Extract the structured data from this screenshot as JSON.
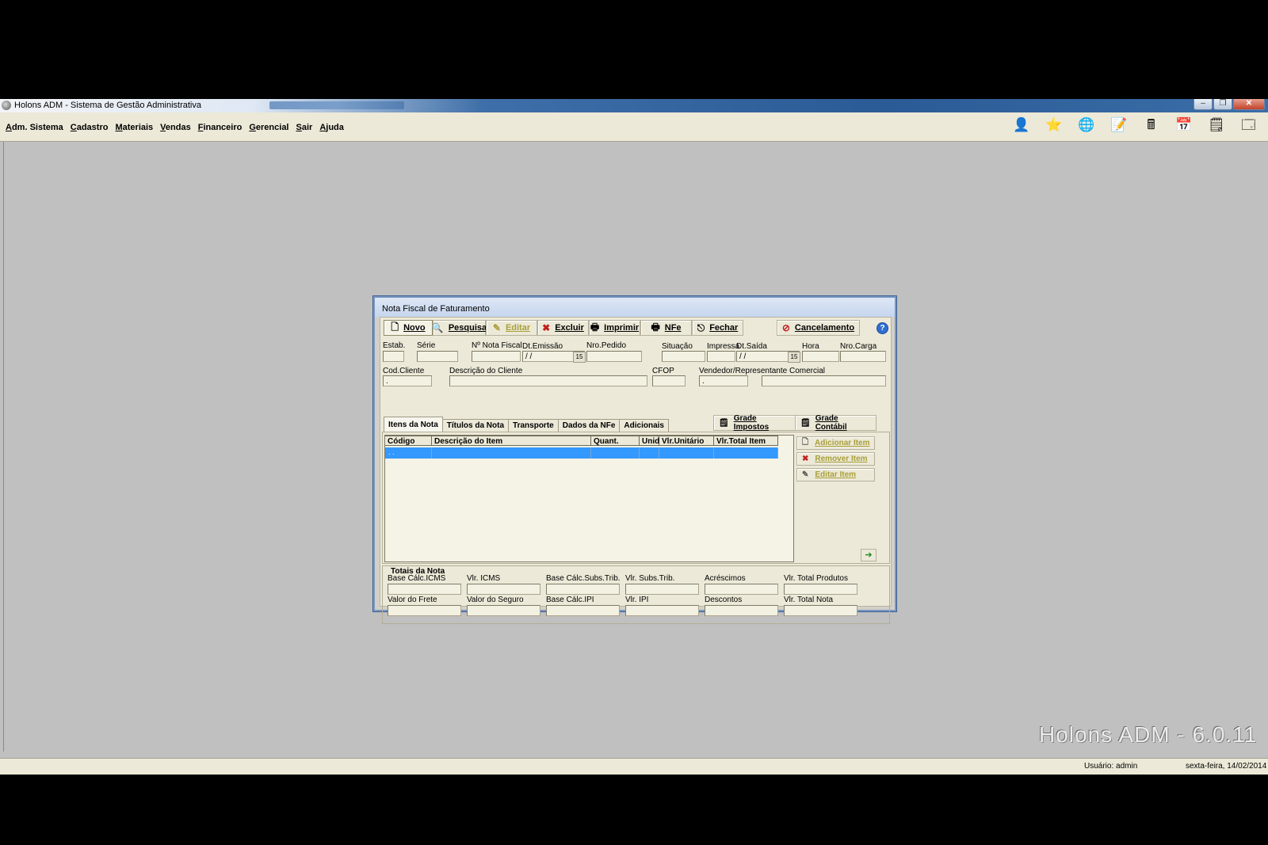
{
  "window": {
    "title": "Holons ADM - Sistema de Gestão Administrativa",
    "controls": {
      "minimize": "–",
      "restore": "❐",
      "close": "✕"
    }
  },
  "menu": [
    {
      "label": "Adm. Sistema",
      "hotkey": "A",
      "rest": "dm. Sistema"
    },
    {
      "label": "Cadastro",
      "hotkey": "C",
      "rest": "adastro"
    },
    {
      "label": "Materiais",
      "hotkey": "M",
      "rest": "ateriais"
    },
    {
      "label": "Vendas",
      "hotkey": "V",
      "rest": "endas"
    },
    {
      "label": "Financeiro",
      "hotkey": "F",
      "rest": "inanceiro"
    },
    {
      "label": "Gerencial",
      "hotkey": "G",
      "rest": "erencial"
    },
    {
      "label": "Sair",
      "hotkey": "S",
      "rest": "air"
    },
    {
      "label": "Ajuda",
      "hotkey": "A",
      "rest": "juda"
    }
  ],
  "toolbar_icons": [
    {
      "name": "user-icon",
      "glyph": "👤"
    },
    {
      "name": "star-icon",
      "glyph": "⭐"
    },
    {
      "name": "globe-icon",
      "glyph": "🌐"
    },
    {
      "name": "notepad-edit-icon",
      "glyph": "📝"
    },
    {
      "name": "calculator-icon",
      "glyph": "🖩"
    },
    {
      "name": "calendar-icon",
      "glyph": "📅"
    },
    {
      "name": "xml-notes-icon",
      "glyph": "🗒"
    },
    {
      "name": "window-icon",
      "glyph": "🗔"
    }
  ],
  "watermark": "Holons ADM - 6.0.11",
  "status": {
    "user": "Usuário: admin",
    "date": "sexta-feira, 14/02/2014"
  },
  "dialog": {
    "title": "Nota Fiscal de Faturamento",
    "buttons": {
      "novo": "Novo",
      "pesquisa": "Pesquisa",
      "editar": "Editar",
      "excluir": "Excluir",
      "imprimir": "Imprimir",
      "nfe": "NFe",
      "fechar": "Fechar",
      "cancelamento": "Cancelamento",
      "help": "?"
    },
    "fields": {
      "estab": "Estab.",
      "serie": "Série",
      "nota_fiscal": "Nº Nota Fiscal",
      "dt_emissao": "Dt.Emissão",
      "nro_pedido": "Nro.Pedido",
      "situacao": "Situação",
      "impressa": "Impressa",
      "dt_saida": "Dt.Saída",
      "hora": "Hora",
      "nro_carga": "Nro.Carga",
      "cod_cliente": "Cod.Cliente",
      "descricao_cliente": "Descrição do Cliente",
      "cfop": "CFOP",
      "vendedor": "Vendedor/Representante Comercial"
    },
    "values": {
      "dt_emissao": " /  /",
      "dt_saida": " /  /",
      "cod_cliente": ".",
      "vendedor": "."
    },
    "tabs": [
      "Itens da Nota",
      "Títulos da Nota",
      "Transporte",
      "Dados da NFe",
      "Adicionais"
    ],
    "grade_buttons": {
      "impostos": "Grade Impostos",
      "contabil": "Grade Contábil"
    },
    "grid": {
      "columns": [
        "Código",
        "Descrição do Item",
        "Quant.",
        "Unid",
        "Vlr.Unitário",
        "Vlr.Total Item"
      ],
      "rows": [
        [
          "  .  .",
          "",
          "",
          "",
          "",
          ""
        ]
      ]
    },
    "item_buttons": {
      "adicionar": "Adicionar Item",
      "remover": "Remover Item",
      "editar": "Editar Item"
    },
    "totals": {
      "title": "Totais da Nota",
      "labels": [
        "Base Cálc.ICMS",
        "Vlr. ICMS",
        "Base Cálc.Subs.Trib.",
        "Vlr. Subs.Trib.",
        "Acréscimos",
        "Vlr. Total Produtos",
        "Valor do Frete",
        "Valor do Seguro",
        "Base Cálc.IPI",
        "Vlr. IPI",
        "Descontos",
        "Vlr. Total Nota"
      ]
    }
  }
}
